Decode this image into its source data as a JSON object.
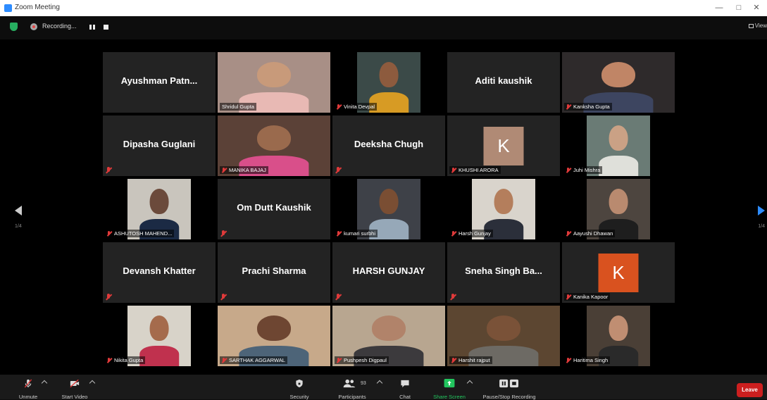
{
  "window": {
    "title": "Zoom Meeting",
    "minimize": "—",
    "maximize": "□",
    "close": "✕"
  },
  "topbar": {
    "recording_label": "Recording...",
    "view_label": "View"
  },
  "gallery": {
    "page_left": "1/4",
    "page_right": "1/4",
    "tiles": [
      {
        "name": "Ayushman  Patn...",
        "type": "name",
        "muted": false
      },
      {
        "name": "Shridul Gupta",
        "type": "video",
        "muted": false,
        "bg": "#a88f86",
        "skin": "#c89a7a",
        "shirt": "#e8b9b4"
      },
      {
        "name": "Vinita Devpal",
        "type": "video",
        "muted": true,
        "bg": "#3b4a48",
        "skin": "#8d5b3e",
        "shirt": "#d79b24"
      },
      {
        "name": "Aditi kaushik",
        "type": "name",
        "muted": false
      },
      {
        "name": "Kanksha Gupta",
        "type": "video",
        "muted": true,
        "bg": "#2e2a2b",
        "skin": "#c08566",
        "shirt": "#3d4560"
      },
      {
        "name": "Dipasha Guglani",
        "type": "name",
        "muted": true
      },
      {
        "name": "MANIKA BAJAJ",
        "type": "video",
        "muted": true,
        "bg": "#5b4137",
        "skin": "#9a6a4d",
        "shirt": "#d94f8a"
      },
      {
        "name": "Deeksha Chugh",
        "type": "name",
        "muted": true
      },
      {
        "name": "KHUSHI ARORA",
        "type": "avatar",
        "muted": true,
        "letter": "K",
        "color": "#b08a75"
      },
      {
        "name": "Juhi Mishra",
        "type": "video",
        "muted": true,
        "bg": "#6a7b75",
        "skin": "#caa185",
        "shirt": "#dfe0da"
      },
      {
        "name": "ASHUTOSH MAHEND...",
        "type": "video",
        "muted": true,
        "bg": "#c9c5bd",
        "skin": "#6b4a3b",
        "shirt": "#1b2a44"
      },
      {
        "name": "Om Dutt Kaushik",
        "type": "name",
        "muted": true
      },
      {
        "name": "kumari surbhi",
        "type": "video",
        "muted": true,
        "bg": "#3e4148",
        "skin": "#7a4e33",
        "shirt": "#96a8b8"
      },
      {
        "name": "Harsh Gunjay",
        "type": "video",
        "muted": true,
        "bg": "#d9d4cc",
        "skin": "#b47e5c",
        "shirt": "#2b2f3a"
      },
      {
        "name": "Aayushi Dhawan",
        "type": "video",
        "muted": true,
        "bg": "#4d453f",
        "skin": "#b98a6f",
        "shirt": "#1e1e1e"
      },
      {
        "name": "Devansh Khatter",
        "type": "name",
        "muted": true
      },
      {
        "name": "Prachi Sharma",
        "type": "name",
        "muted": true
      },
      {
        "name": "HARSH GUNJAY",
        "type": "name",
        "muted": true
      },
      {
        "name": "Sneha Singh Ba...",
        "type": "name",
        "muted": true
      },
      {
        "name": "Kanika Kapoor",
        "type": "avatar",
        "muted": true,
        "letter": "K",
        "color": "#d9521f"
      },
      {
        "name": "Nikita Gupta",
        "type": "video",
        "muted": true,
        "bg": "#d8d3c9",
        "skin": "#a56b4c",
        "shirt": "#c0314e"
      },
      {
        "name": "SARTHAK AGGARWAL",
        "type": "video",
        "muted": true,
        "bg": "#c7a98a",
        "skin": "#6e4632",
        "shirt": "#4d6478"
      },
      {
        "name": "Pushpesh Digpaul",
        "type": "video",
        "muted": true,
        "bg": "#b8a690",
        "skin": "#b1836a",
        "shirt": "#3c3a3d"
      },
      {
        "name": "Harshit rajput",
        "type": "video",
        "muted": true,
        "bg": "#5c4631",
        "skin": "#7a5238",
        "shirt": "#6d6a64"
      },
      {
        "name": "Haritima Singh",
        "type": "video",
        "muted": true,
        "bg": "#4a3f36",
        "skin": "#c08e72",
        "shirt": "#2a2a2a"
      }
    ]
  },
  "toolbar": {
    "unmute": "Unmute",
    "start_video": "Start Video",
    "security": "Security",
    "participants": "Participants",
    "participants_count": "93",
    "chat": "Chat",
    "share_screen": "Share Screen",
    "pause_stop": "Pause/Stop Recording",
    "leave": "Leave"
  },
  "colors": {
    "accent": "#2d8cff",
    "share": "#22c55e",
    "leave": "#cc1f1f",
    "muted": "#e03a3a"
  }
}
